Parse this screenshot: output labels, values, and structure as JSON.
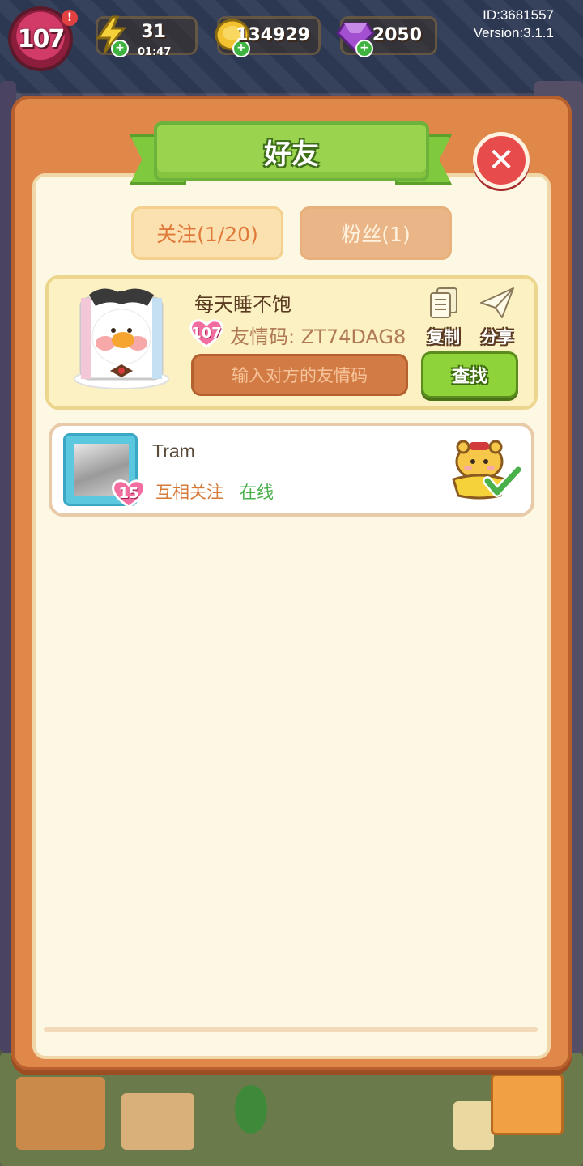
{
  "hud": {
    "level": "107",
    "energy_value": "31",
    "energy_timer": "01:47",
    "coins_value": "134929",
    "gems_value": "2050",
    "id_text": "ID:3681557",
    "version_text": "Version:3.1.1"
  },
  "dialog": {
    "title": "好友",
    "tabs": [
      {
        "label": "关注(1/20)",
        "active": true
      },
      {
        "label": "粉丝(1)",
        "active": false
      }
    ]
  },
  "me": {
    "name": "每天睡不饱",
    "level": "107",
    "code_label": "友情码: ",
    "code_value": "ZT74DAG8",
    "copy_label": "复制",
    "share_label": "分享",
    "input_placeholder": "输入对方的友情码",
    "find_label": "查找"
  },
  "friends": [
    {
      "name": "Tram",
      "level": "15",
      "relation": "互相关注",
      "status": "在线"
    }
  ],
  "colors": {
    "panel": "#e0874a",
    "inner": "#fdf8e3",
    "green": "#8ed33a",
    "close": "#e84b4b"
  }
}
